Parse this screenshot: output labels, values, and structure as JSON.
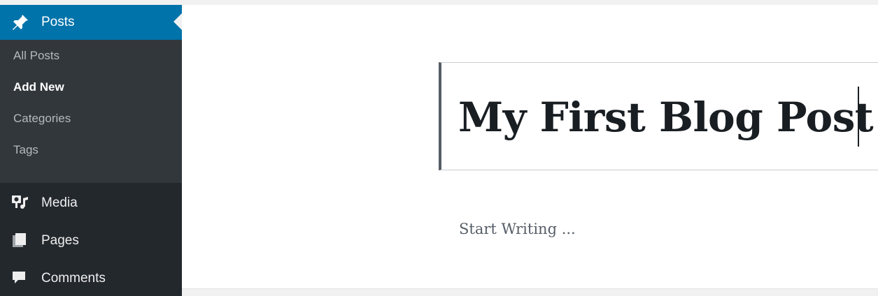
{
  "sidebar": {
    "active": {
      "label": "Posts",
      "icon": "pin-icon"
    },
    "submenu": [
      {
        "label": "All Posts",
        "current": false
      },
      {
        "label": "Add New",
        "current": true
      },
      {
        "label": "Categories",
        "current": false
      },
      {
        "label": "Tags",
        "current": false
      }
    ],
    "items": [
      {
        "label": "Media",
        "icon": "media-icon"
      },
      {
        "label": "Pages",
        "icon": "pages-icon"
      },
      {
        "label": "Comments",
        "icon": "comments-icon"
      }
    ]
  },
  "editor": {
    "title": "My First Blog Post",
    "body_placeholder": "Start Writing ..."
  },
  "colors": {
    "sidebar_bg": "#23282d",
    "submenu_bg": "#32373c",
    "active_bg": "#0073aa",
    "text_dark": "#191e23"
  }
}
